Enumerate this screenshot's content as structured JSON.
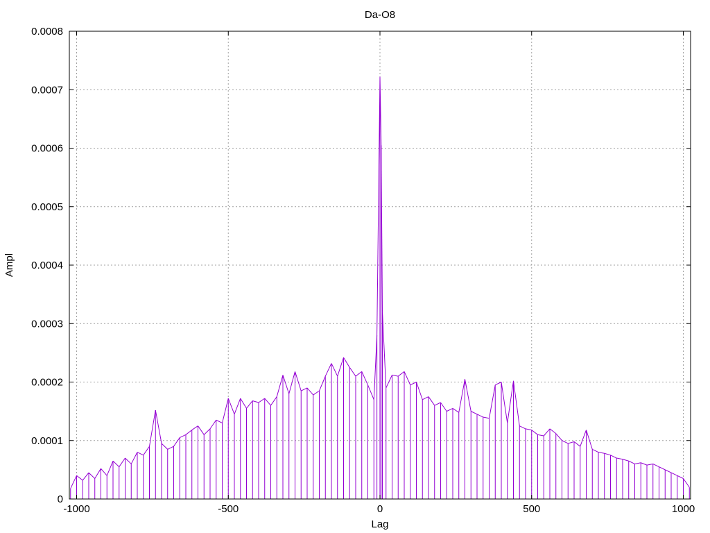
{
  "chart_data": {
    "type": "line",
    "title": "Da-O8",
    "xlabel": "Lag",
    "ylabel": "Ampl",
    "xlim": [
      -1024,
      1024
    ],
    "ylim": [
      0,
      0.0008
    ],
    "x_ticks": [
      {
        "value": -1000,
        "label": "-1000"
      },
      {
        "value": -500,
        "label": "-500"
      },
      {
        "value": 0,
        "label": "0"
      },
      {
        "value": 500,
        "label": "500"
      },
      {
        "value": 1000,
        "label": "1000"
      }
    ],
    "y_ticks": [
      {
        "value": 0,
        "label": "0"
      },
      {
        "value": 0.0001,
        "label": "0.0001"
      },
      {
        "value": 0.0002,
        "label": "0.0002"
      },
      {
        "value": 0.0003,
        "label": "0.0003"
      },
      {
        "value": 0.0004,
        "label": "0.0004"
      },
      {
        "value": 0.0005,
        "label": "0.0005"
      },
      {
        "value": 0.0006,
        "label": "0.0006"
      },
      {
        "value": 0.0007,
        "label": "0.0007"
      },
      {
        "value": 0.0008,
        "label": "0.0008"
      }
    ],
    "grid": true,
    "series": [
      {
        "color": "#9400d3",
        "points": [
          [
            -1020,
            1.8e-05
          ],
          [
            -1000,
            4e-05
          ],
          [
            -980,
            3.2e-05
          ],
          [
            -960,
            4.5e-05
          ],
          [
            -940,
            3.5e-05
          ],
          [
            -920,
            5.2e-05
          ],
          [
            -900,
            4e-05
          ],
          [
            -880,
            6.5e-05
          ],
          [
            -860,
            5.5e-05
          ],
          [
            -840,
            7e-05
          ],
          [
            -820,
            6e-05
          ],
          [
            -800,
            8e-05
          ],
          [
            -780,
            7.5e-05
          ],
          [
            -760,
            9e-05
          ],
          [
            -740,
            0.000152
          ],
          [
            -720,
            9.5e-05
          ],
          [
            -700,
            8.5e-05
          ],
          [
            -680,
            9e-05
          ],
          [
            -660,
            0.000105
          ],
          [
            -640,
            0.00011
          ],
          [
            -620,
            0.000118
          ],
          [
            -600,
            0.000125
          ],
          [
            -580,
            0.00011
          ],
          [
            -560,
            0.00012
          ],
          [
            -540,
            0.000135
          ],
          [
            -520,
            0.00013
          ],
          [
            -500,
            0.000172
          ],
          [
            -480,
            0.000145
          ],
          [
            -460,
            0.000172
          ],
          [
            -440,
            0.000155
          ],
          [
            -420,
            0.000168
          ],
          [
            -400,
            0.000165
          ],
          [
            -380,
            0.000172
          ],
          [
            -360,
            0.00016
          ],
          [
            -340,
            0.000175
          ],
          [
            -320,
            0.000212
          ],
          [
            -300,
            0.00018
          ],
          [
            -280,
            0.000218
          ],
          [
            -260,
            0.000185
          ],
          [
            -240,
            0.00019
          ],
          [
            -220,
            0.000178
          ],
          [
            -200,
            0.000185
          ],
          [
            -180,
            0.00021
          ],
          [
            -160,
            0.000232
          ],
          [
            -140,
            0.00021
          ],
          [
            -120,
            0.000242
          ],
          [
            -100,
            0.000225
          ],
          [
            -80,
            0.00021
          ],
          [
            -60,
            0.000218
          ],
          [
            -40,
            0.000195
          ],
          [
            -20,
            0.00017
          ],
          [
            -10,
            0.00028
          ],
          [
            0,
            0.000722
          ],
          [
            4,
            0.000605
          ],
          [
            8,
            0.00032
          ],
          [
            20,
            0.00019
          ],
          [
            40,
            0.000212
          ],
          [
            60,
            0.00021
          ],
          [
            80,
            0.000218
          ],
          [
            100,
            0.000195
          ],
          [
            120,
            0.0002
          ],
          [
            140,
            0.00017
          ],
          [
            160,
            0.000175
          ],
          [
            180,
            0.00016
          ],
          [
            200,
            0.000165
          ],
          [
            220,
            0.00015
          ],
          [
            240,
            0.000155
          ],
          [
            260,
            0.000148
          ],
          [
            280,
            0.000205
          ],
          [
            300,
            0.00015
          ],
          [
            320,
            0.000145
          ],
          [
            340,
            0.00014
          ],
          [
            360,
            0.000138
          ],
          [
            380,
            0.000195
          ],
          [
            400,
            0.0002
          ],
          [
            420,
            0.00013
          ],
          [
            440,
            0.000202
          ],
          [
            460,
            0.000125
          ],
          [
            480,
            0.00012
          ],
          [
            500,
            0.000118
          ],
          [
            520,
            0.00011
          ],
          [
            540,
            0.000108
          ],
          [
            560,
            0.00012
          ],
          [
            580,
            0.000112
          ],
          [
            600,
            0.0001
          ],
          [
            620,
            9.5e-05
          ],
          [
            640,
            9.8e-05
          ],
          [
            660,
            9e-05
          ],
          [
            680,
            0.000118
          ],
          [
            700,
            8.5e-05
          ],
          [
            720,
            8e-05
          ],
          [
            740,
            7.8e-05
          ],
          [
            760,
            7.5e-05
          ],
          [
            780,
            7e-05
          ],
          [
            800,
            6.8e-05
          ],
          [
            820,
            6.5e-05
          ],
          [
            840,
            6e-05
          ],
          [
            860,
            6.2e-05
          ],
          [
            880,
            5.8e-05
          ],
          [
            900,
            6e-05
          ],
          [
            920,
            5.5e-05
          ],
          [
            940,
            5e-05
          ],
          [
            960,
            4.5e-05
          ],
          [
            980,
            4e-05
          ],
          [
            1000,
            3.5e-05
          ],
          [
            1020,
            2e-05
          ]
        ]
      }
    ]
  }
}
